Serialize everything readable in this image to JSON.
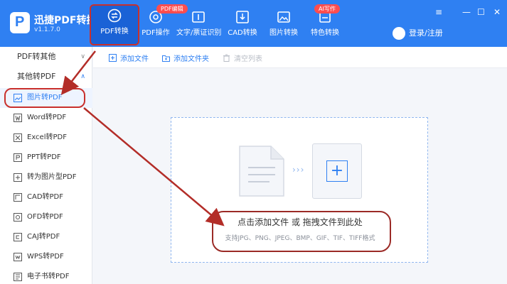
{
  "app": {
    "name": "迅捷PDF转换器",
    "version": "v1.1.7.0",
    "logo_letter": "P"
  },
  "nav": [
    {
      "label": "PDF转换",
      "icon": "convert-icon",
      "active": true
    },
    {
      "label": "PDF操作",
      "icon": "pdf-operate-icon",
      "badge": "PDF编辑"
    },
    {
      "label": "文字/票证识别",
      "icon": "ocr-icon"
    },
    {
      "label": "CAD转换",
      "icon": "cad-icon"
    },
    {
      "label": "图片转换",
      "icon": "image-icon"
    },
    {
      "label": "特色转换",
      "icon": "special-icon",
      "badge": "AI写作"
    }
  ],
  "window": {
    "menu": "≡",
    "minimize": "—",
    "maximize": "☐",
    "close": "✕"
  },
  "login_label": "登录/注册",
  "sidebar": {
    "groups": [
      {
        "label": "PDF转其他",
        "chevron": "∨"
      },
      {
        "label": "其他转PDF",
        "chevron": "∧"
      }
    ],
    "items": [
      {
        "label": "图片转PDF",
        "active": true
      },
      {
        "label": "Word转PDF"
      },
      {
        "label": "Excel转PDF"
      },
      {
        "label": "PPT转PDF"
      },
      {
        "label": "转为图片型PDF"
      },
      {
        "label": "CAD转PDF"
      },
      {
        "label": "OFD转PDF"
      },
      {
        "label": "CAJ转PDF"
      },
      {
        "label": "WPS转PDF"
      },
      {
        "label": "电子书转PDF"
      }
    ]
  },
  "toolbar": {
    "add_file": "添加文件",
    "add_folder": "添加文件夹",
    "clear_list": "清空列表"
  },
  "dropzone": {
    "arrows": "›››",
    "plus": "+",
    "main_text": "点击添加文件 或 拖拽文件到此处",
    "formats": "支持JPG、PNG、JPEG、BMP、GIF、TIF、TIFF格式"
  },
  "colors": {
    "primary": "#2f80f2",
    "active_nav": "#1a62d6",
    "annotation": "#c9302c"
  }
}
